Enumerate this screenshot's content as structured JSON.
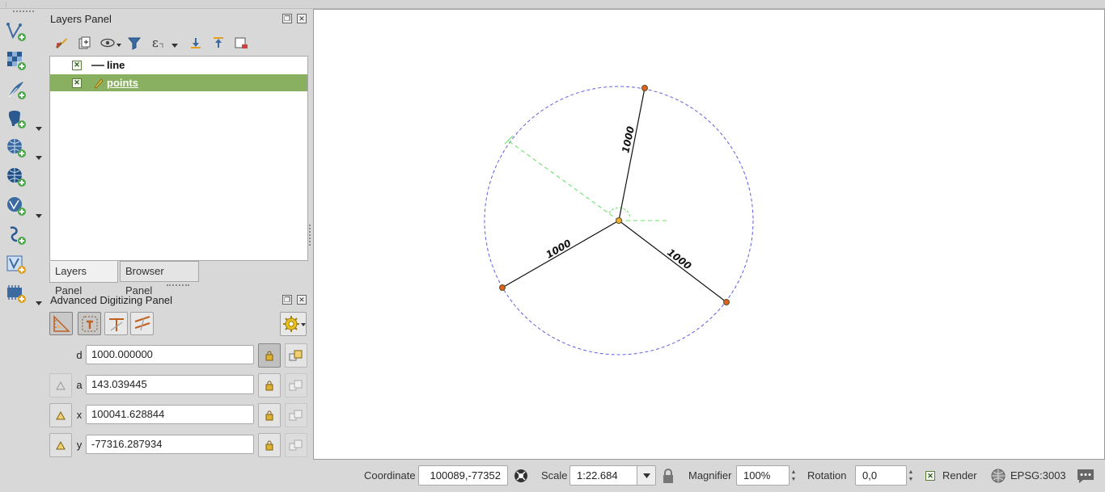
{
  "layers_panel": {
    "title": "Layers Panel",
    "layers": [
      {
        "name": "line",
        "visible": true,
        "selected": false
      },
      {
        "name": "points",
        "visible": true,
        "selected": true
      }
    ],
    "tabs": [
      "Layers Panel",
      "Browser Panel"
    ]
  },
  "adv_panel": {
    "title": "Advanced Digitizing Panel",
    "fields": [
      {
        "label": "d",
        "value": "1000.000000"
      },
      {
        "label": "a",
        "value": "143.039445"
      },
      {
        "label": "x",
        "value": "100041.628844"
      },
      {
        "label": "y",
        "value": "-77316.287934"
      }
    ]
  },
  "map": {
    "labels": [
      "1000",
      "1000",
      "1000"
    ]
  },
  "statusbar": {
    "coordinate_label": "Coordinate",
    "coordinate_value": "100089,-77352",
    "scale_label": "Scale",
    "scale_value": "1:22.684",
    "magnifier_label": "Magnifier",
    "magnifier_value": "100%",
    "rotation_label": "Rotation",
    "rotation_value": "0,0",
    "render_label": "Render",
    "crs_label": "EPSG:3003"
  },
  "colors": {
    "selected_row": "#88b060",
    "circle": "#6060e0",
    "guide": "#60e060",
    "vertex": "#e06020"
  }
}
